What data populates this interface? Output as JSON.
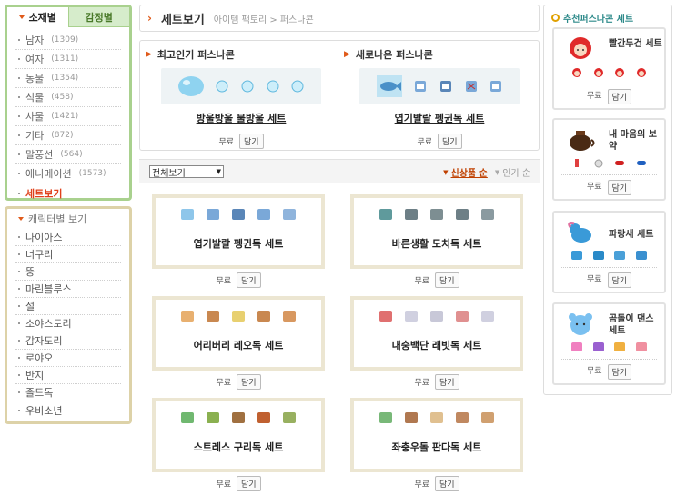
{
  "sidebar": {
    "tabs": [
      "소재별",
      "감정별"
    ],
    "categories": [
      {
        "label": "남자",
        "count": "(1309)"
      },
      {
        "label": "여자",
        "count": "(1311)"
      },
      {
        "label": "동물",
        "count": "(1354)"
      },
      {
        "label": "식물",
        "count": "(458)"
      },
      {
        "label": "사물",
        "count": "(1421)"
      },
      {
        "label": "기타",
        "count": "(872)"
      },
      {
        "label": "말풍선",
        "count": "(564)"
      },
      {
        "label": "애니메이션",
        "count": "(1573)"
      },
      {
        "label": "세트보기",
        "count": ""
      }
    ],
    "character_title": "캐릭터별 보기",
    "characters": [
      "나이아스",
      "너구리",
      "뚱",
      "마린블루스",
      "설",
      "소야스토리",
      "감자도리",
      "로야오",
      "반지",
      "졸드독",
      "우비소년"
    ]
  },
  "header": {
    "title": "세트보기",
    "breadcrumb": "아이템 팩토리 > 퍼스나콘"
  },
  "featured": {
    "popular_title": "최고인기 퍼스나콘",
    "popular_name": "방울방울 물방울 세트",
    "new_title": "새로나온 퍼스나콘",
    "new_name": "엽기발랄 펭귄독 세트",
    "free": "무료",
    "add": "담기"
  },
  "filter": {
    "select_value": "전체보기",
    "sort_new": "신상품 순",
    "sort_popular": "인기 순"
  },
  "sets": [
    {
      "name": "엽기발랄 펭귄독 세트",
      "free": "무료",
      "add": "담기"
    },
    {
      "name": "바른생활 도치독 세트",
      "free": "무료",
      "add": "담기"
    },
    {
      "name": "어리버리 레오독 세트",
      "free": "무료",
      "add": "담기"
    },
    {
      "name": "내숭백단 래빗독 세트",
      "free": "무료",
      "add": "담기"
    },
    {
      "name": "스트레스 구리독 세트",
      "free": "무료",
      "add": "담기"
    },
    {
      "name": "좌충우돌 판다독 세트",
      "free": "무료",
      "add": "담기"
    }
  ],
  "recommended": {
    "title": "추천퍼스나콘 세트",
    "items": [
      {
        "name": "빨간두건 세트",
        "free": "무료",
        "add": "담기"
      },
      {
        "name": "내 마음의 보약",
        "free": "무료",
        "add": "담기"
      },
      {
        "name": "파랑새 세트",
        "free": "무료",
        "add": "담기"
      },
      {
        "name": "곰돌이 댄스 세트",
        "free": "무료",
        "add": "담기"
      }
    ]
  },
  "colors": {
    "accent": "#e05a1a",
    "sidebar_border": "#a9d18e",
    "char_border": "#ddd2a8",
    "card_border": "#ece6d2",
    "recommended_title": "#2e8a8a"
  }
}
